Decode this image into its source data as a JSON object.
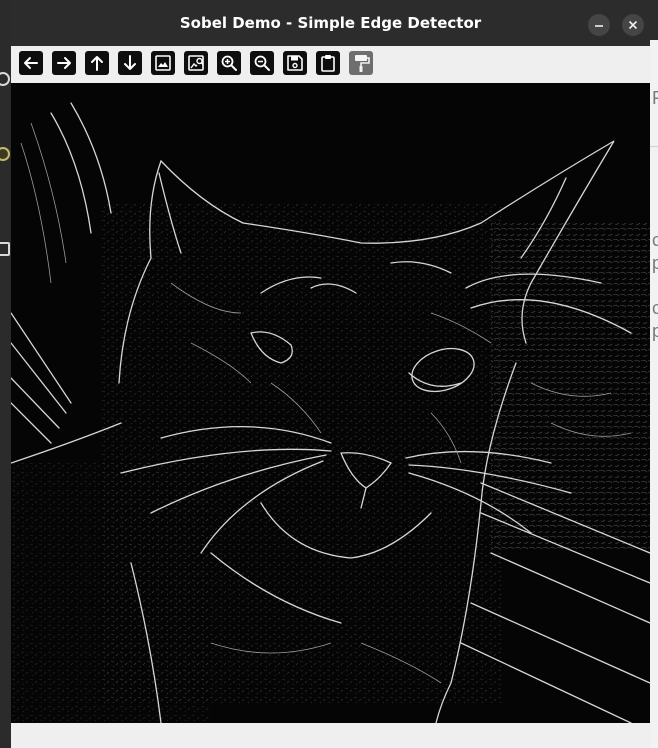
{
  "window": {
    "title": "Sobel Demo - Simple Edge Detector",
    "controls": [
      "minimize-icon",
      "close-icon"
    ]
  },
  "toolbar": {
    "buttons": [
      {
        "icon": "arrow-left-icon"
      },
      {
        "icon": "arrow-right-icon"
      },
      {
        "icon": "arrow-up-icon"
      },
      {
        "icon": "arrow-down-icon"
      },
      {
        "icon": "image-icon"
      },
      {
        "icon": "image-search-icon"
      },
      {
        "icon": "zoom-in-icon"
      },
      {
        "icon": "zoom-out-icon"
      },
      {
        "icon": "save-icon"
      },
      {
        "icon": "clipboard-icon"
      },
      {
        "icon": "paint-roller-icon",
        "state": "disabled"
      }
    ]
  },
  "background_app": {
    "fragments": [
      "F",
      "c",
      "p",
      "c",
      "p"
    ]
  },
  "statusbar": {
    "text": ""
  },
  "colors": {
    "titlebar": "#2c2c2c",
    "toolbar": "#efefef",
    "button": "#0e0e0e",
    "button_disabled": "#6e6e6e",
    "canvas": "#050505",
    "edges": "#d9d9d9"
  }
}
